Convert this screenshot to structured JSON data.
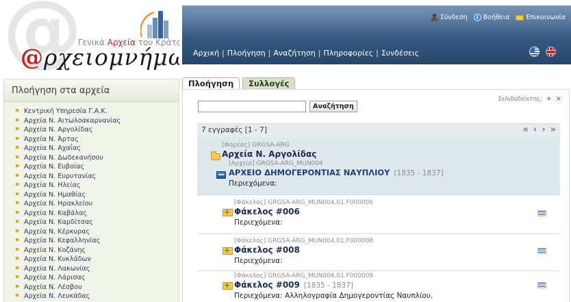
{
  "logo": {
    "subtitle_part1": "Γενικά ",
    "subtitle_part2": "Αρχεία",
    "subtitle_part3": " του Κράτους",
    "brand_at": "@",
    "brand_text": "ρχειομνήμων"
  },
  "sidebar": {
    "title": "Πλοήγηση στα αρχεία",
    "items": [
      "Κεντρική Υπηρεσία Γ.Α.Κ.",
      "Αρχεία Ν. Αιτωλοακαρνανίας",
      "Αρχεία Ν. Αργολίδας",
      "Αρχεία Ν. Άρτας",
      "Αρχεία Ν. Αχαΐας",
      "Αρχεία Ν. Δωδεκανήσου",
      "Αρχεία Ν. Ευβοίας",
      "Αρχεία Ν. Ευρυτανίας",
      "Αρχεία Ν. Ηλείας",
      "Αρχεία Ν. Ημαθίας",
      "Αρχεία Ν. Ηρακλείου",
      "Αρχεία Ν. Καβάλας",
      "Αρχεία Ν. Καρδίτσας",
      "Αρχεία Ν. Κέρκυρας",
      "Αρχεία Ν. Κεφαλληνίας",
      "Αρχεία Ν. Κοζάνης",
      "Αρχεία Ν. Κυκλάδων",
      "Αρχεία Ν. Λακωνίας",
      "Αρχεία Ν. Λάρισας",
      "Αρχεία Ν. Λέσβου",
      "Αρχεία Ν. Λευκάδας"
    ]
  },
  "header": {
    "toplinks": {
      "login": "Σύνδεση",
      "help": "Βοήθεια",
      "contact": "Επικοινωνία"
    },
    "nav": [
      "Αρχική",
      "Πλοήγηση",
      "Αναζήτηση",
      "Πληροφορίες",
      "Συνδέσεις"
    ],
    "icons": {
      "login": "user-icon",
      "help": "help-icon",
      "contact": "mail-icon"
    }
  },
  "tabs": {
    "active": "Πλοήγηση",
    "inactive": "Συλλογές"
  },
  "panel": {
    "bookmarks_label": "Σελιδοδείκτης:",
    "bookmark_add": "+",
    "bookmark_remove": "×",
    "search_button": "Αναζήτηση",
    "search_value": "",
    "result_count": "7 εγγραφές [1 - 7]",
    "pager": {
      "first": "«",
      "prev": "‹",
      "next": "›",
      "last": "»"
    }
  },
  "records": {
    "group": {
      "meta": "[Φορέας] GRGSA-ARG",
      "title": "Αρχεία Ν. Αργολίδας",
      "fonds_meta": "[Αρχείο] GRGSA-ARG_MUN004",
      "fonds_title": "ΑΡΧΕΙΟ ΔΗΜΟΓΕΡΟΝΤΙΑΣ ΝΑΥΠΛΙΟΥ",
      "fonds_dates": "[1835 - 1837]",
      "contents": "Περιεχόμενα:"
    },
    "items": [
      {
        "meta": "[Φάκελος] GRGSA-ARG_MUN004.01.F000006",
        "title": "Φάκελος #006",
        "dates": "",
        "contents": "Περιεχόμενα:"
      },
      {
        "meta": "[Φάκελος] GRGSA-ARG_MUN004.01.F000008",
        "title": "Φάκελος #008",
        "dates": "",
        "contents": "Περιεχόμενα:"
      },
      {
        "meta": "[Φάκελος] GRGSA-ARG_MUN004.01.F000009",
        "title": "Φάκελος #009",
        "dates": "[1835 - 1837]",
        "contents": "Περιεχόμενα: Αλληλογραφία Δημογεροντίας Ναυπλίου."
      }
    ]
  },
  "colors": {
    "header_top": "#5a7ea5",
    "header_bottom": "#274769",
    "accent_red": "#d21616",
    "bullet": "#e6a317",
    "record_title": "#1e2a55"
  }
}
